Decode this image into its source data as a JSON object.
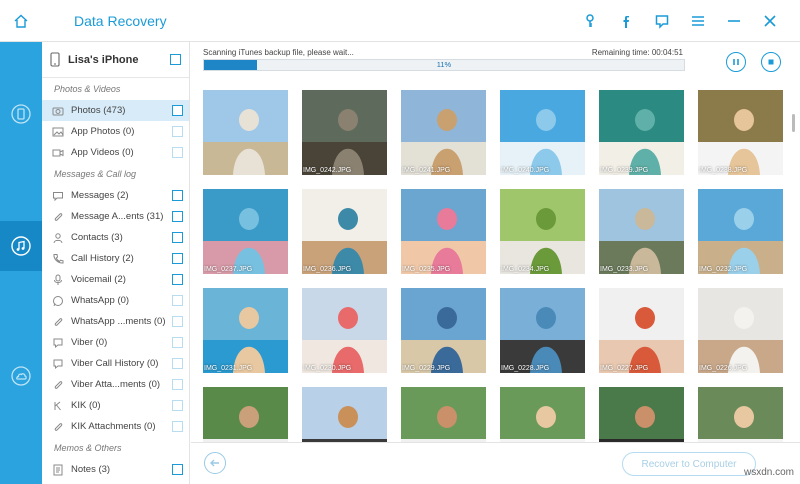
{
  "app": {
    "title": "Data Recovery"
  },
  "titlebar": {
    "icons": [
      "key-icon",
      "facebook-icon",
      "feedback-icon",
      "menu-icon",
      "minimize-icon",
      "close-icon"
    ]
  },
  "device": {
    "name": "Lisa's iPhone"
  },
  "sidebar": {
    "groups": [
      {
        "heading": "Photos & Videos",
        "items": [
          {
            "label": "Photos (473)",
            "icon": "photo-icon",
            "selected": true,
            "checked_style": "active"
          },
          {
            "label": "App Photos (0)",
            "icon": "image-icon",
            "checked_style": "dim"
          },
          {
            "label": "App Videos (0)",
            "icon": "video-icon",
            "checked_style": "dim"
          }
        ]
      },
      {
        "heading": "Messages & Call log",
        "items": [
          {
            "label": "Messages (2)",
            "icon": "message-icon",
            "checked_style": "active"
          },
          {
            "label": "Message A...ents (31)",
            "icon": "attachment-icon",
            "checked_style": "active"
          },
          {
            "label": "Contacts (3)",
            "icon": "contact-icon",
            "checked_style": "active"
          },
          {
            "label": "Call History (2)",
            "icon": "phone-icon",
            "checked_style": "active"
          },
          {
            "label": "Voicemail (2)",
            "icon": "voicemail-icon",
            "checked_style": "active"
          },
          {
            "label": "WhatsApp (0)",
            "icon": "whatsapp-icon",
            "checked_style": "dim"
          },
          {
            "label": "WhatsApp ...ments (0)",
            "icon": "attachment-icon",
            "checked_style": "dim"
          },
          {
            "label": "Viber (0)",
            "icon": "viber-icon",
            "checked_style": "dim"
          },
          {
            "label": "Viber Call History (0)",
            "icon": "viber-call-icon",
            "checked_style": "dim"
          },
          {
            "label": "Viber Atta...ments (0)",
            "icon": "attachment-icon",
            "checked_style": "dim"
          },
          {
            "label": "KIK (0)",
            "icon": "kik-icon",
            "checked_style": "dim"
          },
          {
            "label": "KIK Attachments (0)",
            "icon": "attachment-icon",
            "checked_style": "dim"
          }
        ]
      },
      {
        "heading": "Memos & Others",
        "items": [
          {
            "label": "Notes (3)",
            "icon": "notes-icon",
            "checked_style": "active"
          }
        ]
      }
    ]
  },
  "scan": {
    "status": "Scanning iTunes backup file, please wait...",
    "remaining": "Remaining time: 00:04:51",
    "percent_label": "11%",
    "progress": 0.11
  },
  "photos": [
    {
      "caption": "",
      "colors": [
        "#9fc8e8",
        "#e8e2d6",
        "#c9b896"
      ]
    },
    {
      "caption": "IMG_0242.JPG",
      "colors": [
        "#5e6a5c",
        "#8a8170",
        "#4a4438"
      ]
    },
    {
      "caption": "IMG_0241.JPG",
      "colors": [
        "#8fb6d8",
        "#c9a070",
        "#e3e0d6"
      ]
    },
    {
      "caption": "IMG_0240.JPG",
      "colors": [
        "#4aa8e0",
        "#8cc9ea",
        "#e6f2f8"
      ]
    },
    {
      "caption": "IMG_0239.JPG",
      "colors": [
        "#2b8a82",
        "#5fb0a8",
        "#f2efe6"
      ]
    },
    {
      "caption": "IMG_0238.JPG",
      "colors": [
        "#8b7a4a",
        "#e6c59a",
        "#f4f4f4"
      ]
    },
    {
      "caption": "IMG_0237.JPG",
      "colors": [
        "#3b9bc8",
        "#78c0e0",
        "#d89aa8"
      ]
    },
    {
      "caption": "IMG_0236.JPG",
      "colors": [
        "#f2efe8",
        "#3d8aa8",
        "#c9a27a"
      ]
    },
    {
      "caption": "IMG_0235.JPG",
      "colors": [
        "#6aa6d0",
        "#e87a9a",
        "#f0c8a8"
      ]
    },
    {
      "caption": "IMG_0234.JPG",
      "colors": [
        "#9fc66a",
        "#6a9a3a",
        "#e9e6e0"
      ]
    },
    {
      "caption": "IMG_0233.JPG",
      "colors": [
        "#9fc4e0",
        "#c9b89a",
        "#6a7a5a"
      ]
    },
    {
      "caption": "IMG_0232.JPG",
      "colors": [
        "#5aa8d8",
        "#9ad0ea",
        "#c9b08a"
      ]
    },
    {
      "caption": "IMG_0231.JPG",
      "colors": [
        "#6ab4d8",
        "#e8c8a0",
        "#2a9ad0"
      ]
    },
    {
      "caption": "IMG_0230.JPG",
      "colors": [
        "#c8d8e8",
        "#e86a6a",
        "#f0e8e0"
      ]
    },
    {
      "caption": "IMG_0229.JPG",
      "colors": [
        "#6aa4d0",
        "#3a6a9a",
        "#d8c8a8"
      ]
    },
    {
      "caption": "IMG_0228.JPG",
      "colors": [
        "#7ab0d8",
        "#4a8ab8",
        "#3a3a3a"
      ]
    },
    {
      "caption": "IMG_0227.JPG",
      "colors": [
        "#f0f0f0",
        "#d85a3a",
        "#e8c8b0"
      ]
    },
    {
      "caption": "IMG_0226.JPG",
      "colors": [
        "#e8e6e2",
        "#f4f2ee",
        "#c9a88a"
      ]
    },
    {
      "caption": "",
      "colors": [
        "#5a8a4a",
        "#c9a07a",
        "#f0f0f0"
      ]
    },
    {
      "caption": "",
      "colors": [
        "#b8d0e8",
        "#c9905a",
        "#3a3a3a"
      ]
    },
    {
      "caption": "",
      "colors": [
        "#6a9a5a",
        "#c9906a",
        "#f0f0f0"
      ]
    },
    {
      "caption": "",
      "colors": [
        "#6a9a5a",
        "#e8c8a0",
        "#f4f4f4"
      ]
    },
    {
      "caption": "",
      "colors": [
        "#4a7a4a",
        "#c9906a",
        "#2a2a2a"
      ]
    },
    {
      "caption": "",
      "colors": [
        "#6a8a5a",
        "#e8c8a0",
        "#f4f4f4"
      ]
    }
  ],
  "footer": {
    "recover_label": "Recover to Computer"
  },
  "watermark": "wsxdn.com"
}
